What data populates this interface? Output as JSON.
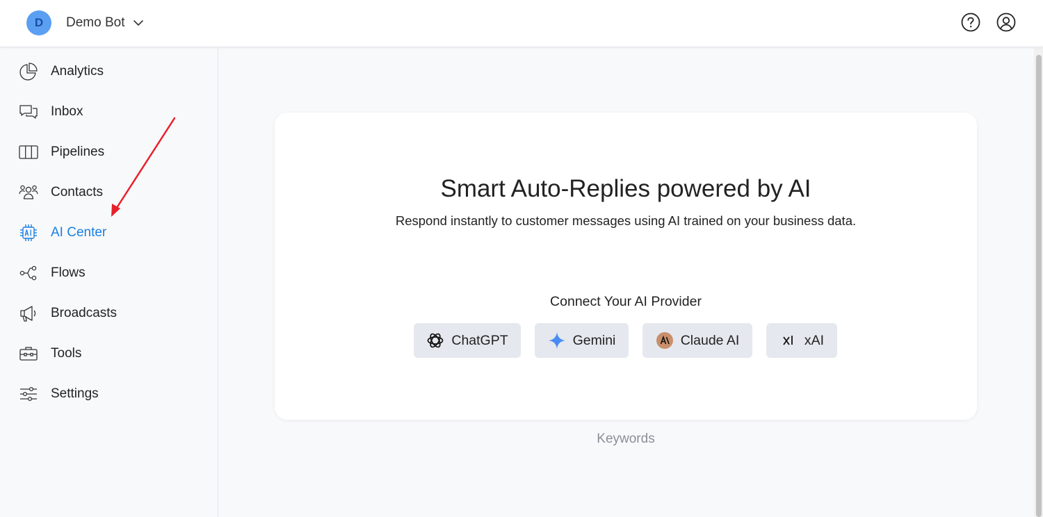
{
  "header": {
    "bot_initial": "D",
    "bot_name": "Demo Bot",
    "avatar_bg": "#5a9ff2",
    "avatar_fg": "#1a4fa0"
  },
  "sidebar": {
    "items": [
      {
        "label": "Analytics",
        "icon": "pie-chart-icon"
      },
      {
        "label": "Inbox",
        "icon": "chat-bubbles-icon"
      },
      {
        "label": "Pipelines",
        "icon": "columns-icon"
      },
      {
        "label": "Contacts",
        "icon": "users-icon"
      },
      {
        "label": "AI Center",
        "icon": "ai-chip-icon",
        "active": true
      },
      {
        "label": "Flows",
        "icon": "flow-icon"
      },
      {
        "label": "Broadcasts",
        "icon": "megaphone-icon"
      },
      {
        "label": "Tools",
        "icon": "toolbox-icon"
      },
      {
        "label": "Settings",
        "icon": "sliders-icon"
      }
    ]
  },
  "main": {
    "headline": "Smart Auto-Replies powered by AI",
    "subline": "Respond instantly to customer messages using AI trained on your business data.",
    "connect_label": "Connect Your AI Provider",
    "providers": [
      {
        "label": "ChatGPT",
        "icon": "openai-icon"
      },
      {
        "label": "Gemini",
        "icon": "gemini-sparkle-icon"
      },
      {
        "label": "Claude AI",
        "icon": "claude-icon"
      },
      {
        "label": "xAI",
        "icon": "xai-icon"
      }
    ],
    "keywords_label": "Keywords"
  },
  "colors": {
    "accent": "#1a7fe0",
    "annotation_arrow": "#e8202a",
    "gemini": "#4a8af4",
    "claude": "#c98f6b"
  }
}
